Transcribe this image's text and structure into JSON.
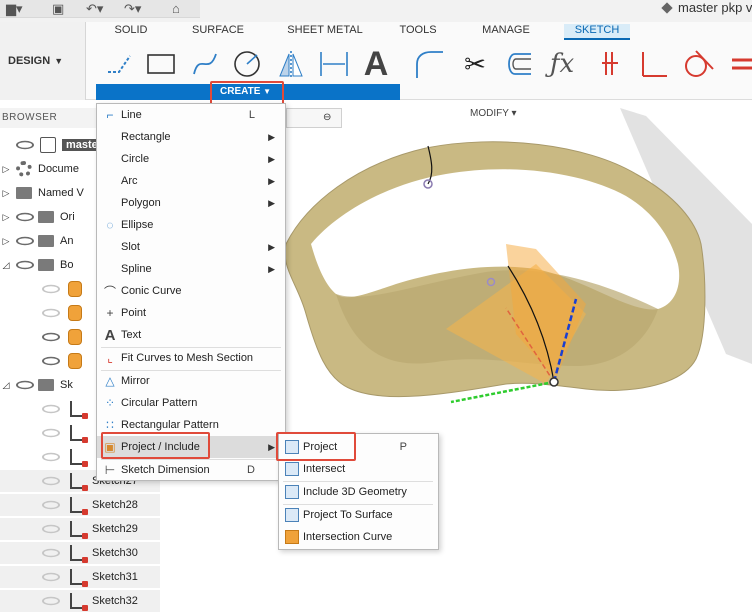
{
  "window": {
    "doc_title": "master pkp v"
  },
  "ribbon": {
    "workspace": "DESIGN",
    "tabs": [
      "SOLID",
      "SURFACE",
      "SHEET METAL",
      "TOOLS",
      "MANAGE",
      "SKETCH"
    ],
    "active_tab": "SKETCH",
    "create_label": "CREATE",
    "modify_label": "MODIFY"
  },
  "browser": {
    "title": "BROWSER",
    "rows": [
      {
        "label": "maste"
      },
      {
        "label": "Docume"
      },
      {
        "label": "Named V"
      },
      {
        "label": "Ori"
      },
      {
        "label": "An"
      },
      {
        "label": "Bo"
      },
      {
        "label": ""
      },
      {
        "label": ""
      },
      {
        "label": ""
      },
      {
        "label": ""
      },
      {
        "label": "Sk"
      },
      {
        "label": ""
      },
      {
        "label": ""
      },
      {
        "label": ""
      },
      {
        "label": "Sketch27"
      },
      {
        "label": "Sketch28"
      },
      {
        "label": "Sketch29"
      },
      {
        "label": "Sketch30"
      },
      {
        "label": "Sketch31"
      },
      {
        "label": "Sketch32"
      }
    ]
  },
  "create_menu": {
    "items": [
      {
        "label": "Line",
        "shortcut": "L"
      },
      {
        "label": "Rectangle",
        "submenu": true
      },
      {
        "label": "Circle",
        "submenu": true
      },
      {
        "label": "Arc",
        "submenu": true
      },
      {
        "label": "Polygon",
        "submenu": true
      },
      {
        "label": "Ellipse"
      },
      {
        "label": "Slot",
        "submenu": true
      },
      {
        "label": "Spline",
        "submenu": true
      },
      {
        "label": "Conic Curve"
      },
      {
        "label": "Point"
      },
      {
        "label": "Text"
      },
      {
        "label": "Fit Curves to Mesh Section"
      },
      {
        "label": "Mirror"
      },
      {
        "label": "Circular Pattern"
      },
      {
        "label": "Rectangular Pattern"
      },
      {
        "label": "Project / Include",
        "submenu": true
      },
      {
        "label": "Sketch Dimension",
        "shortcut": "D"
      }
    ]
  },
  "project_submenu": {
    "items": [
      {
        "label": "Project",
        "shortcut": "P"
      },
      {
        "label": "Intersect"
      },
      {
        "label": "Include 3D Geometry"
      },
      {
        "label": "Project To Surface"
      },
      {
        "label": "Intersection Curve"
      }
    ]
  },
  "colors": {
    "accent": "#0a73c8",
    "highlight": "#e04a3a",
    "body": "#cdbf87"
  }
}
